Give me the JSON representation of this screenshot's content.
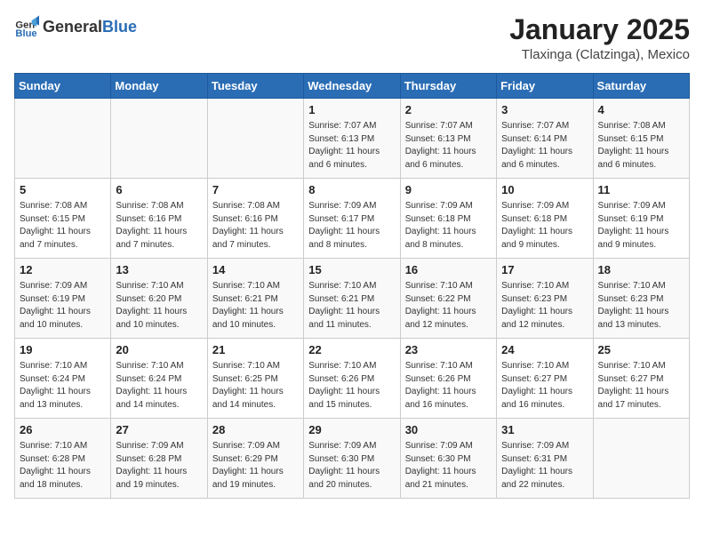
{
  "header": {
    "logo_general": "General",
    "logo_blue": "Blue",
    "title": "January 2025",
    "subtitle": "Tlaxinga (Clatzinga), Mexico"
  },
  "days_of_week": [
    "Sunday",
    "Monday",
    "Tuesday",
    "Wednesday",
    "Thursday",
    "Friday",
    "Saturday"
  ],
  "weeks": [
    [
      {
        "day": "",
        "info": ""
      },
      {
        "day": "",
        "info": ""
      },
      {
        "day": "",
        "info": ""
      },
      {
        "day": "1",
        "info": "Sunrise: 7:07 AM\nSunset: 6:13 PM\nDaylight: 11 hours\nand 6 minutes."
      },
      {
        "day": "2",
        "info": "Sunrise: 7:07 AM\nSunset: 6:13 PM\nDaylight: 11 hours\nand 6 minutes."
      },
      {
        "day": "3",
        "info": "Sunrise: 7:07 AM\nSunset: 6:14 PM\nDaylight: 11 hours\nand 6 minutes."
      },
      {
        "day": "4",
        "info": "Sunrise: 7:08 AM\nSunset: 6:15 PM\nDaylight: 11 hours\nand 6 minutes."
      }
    ],
    [
      {
        "day": "5",
        "info": "Sunrise: 7:08 AM\nSunset: 6:15 PM\nDaylight: 11 hours\nand 7 minutes."
      },
      {
        "day": "6",
        "info": "Sunrise: 7:08 AM\nSunset: 6:16 PM\nDaylight: 11 hours\nand 7 minutes."
      },
      {
        "day": "7",
        "info": "Sunrise: 7:08 AM\nSunset: 6:16 PM\nDaylight: 11 hours\nand 7 minutes."
      },
      {
        "day": "8",
        "info": "Sunrise: 7:09 AM\nSunset: 6:17 PM\nDaylight: 11 hours\nand 8 minutes."
      },
      {
        "day": "9",
        "info": "Sunrise: 7:09 AM\nSunset: 6:18 PM\nDaylight: 11 hours\nand 8 minutes."
      },
      {
        "day": "10",
        "info": "Sunrise: 7:09 AM\nSunset: 6:18 PM\nDaylight: 11 hours\nand 9 minutes."
      },
      {
        "day": "11",
        "info": "Sunrise: 7:09 AM\nSunset: 6:19 PM\nDaylight: 11 hours\nand 9 minutes."
      }
    ],
    [
      {
        "day": "12",
        "info": "Sunrise: 7:09 AM\nSunset: 6:19 PM\nDaylight: 11 hours\nand 10 minutes."
      },
      {
        "day": "13",
        "info": "Sunrise: 7:10 AM\nSunset: 6:20 PM\nDaylight: 11 hours\nand 10 minutes."
      },
      {
        "day": "14",
        "info": "Sunrise: 7:10 AM\nSunset: 6:21 PM\nDaylight: 11 hours\nand 10 minutes."
      },
      {
        "day": "15",
        "info": "Sunrise: 7:10 AM\nSunset: 6:21 PM\nDaylight: 11 hours\nand 11 minutes."
      },
      {
        "day": "16",
        "info": "Sunrise: 7:10 AM\nSunset: 6:22 PM\nDaylight: 11 hours\nand 12 minutes."
      },
      {
        "day": "17",
        "info": "Sunrise: 7:10 AM\nSunset: 6:23 PM\nDaylight: 11 hours\nand 12 minutes."
      },
      {
        "day": "18",
        "info": "Sunrise: 7:10 AM\nSunset: 6:23 PM\nDaylight: 11 hours\nand 13 minutes."
      }
    ],
    [
      {
        "day": "19",
        "info": "Sunrise: 7:10 AM\nSunset: 6:24 PM\nDaylight: 11 hours\nand 13 minutes."
      },
      {
        "day": "20",
        "info": "Sunrise: 7:10 AM\nSunset: 6:24 PM\nDaylight: 11 hours\nand 14 minutes."
      },
      {
        "day": "21",
        "info": "Sunrise: 7:10 AM\nSunset: 6:25 PM\nDaylight: 11 hours\nand 14 minutes."
      },
      {
        "day": "22",
        "info": "Sunrise: 7:10 AM\nSunset: 6:26 PM\nDaylight: 11 hours\nand 15 minutes."
      },
      {
        "day": "23",
        "info": "Sunrise: 7:10 AM\nSunset: 6:26 PM\nDaylight: 11 hours\nand 16 minutes."
      },
      {
        "day": "24",
        "info": "Sunrise: 7:10 AM\nSunset: 6:27 PM\nDaylight: 11 hours\nand 16 minutes."
      },
      {
        "day": "25",
        "info": "Sunrise: 7:10 AM\nSunset: 6:27 PM\nDaylight: 11 hours\nand 17 minutes."
      }
    ],
    [
      {
        "day": "26",
        "info": "Sunrise: 7:10 AM\nSunset: 6:28 PM\nDaylight: 11 hours\nand 18 minutes."
      },
      {
        "day": "27",
        "info": "Sunrise: 7:09 AM\nSunset: 6:28 PM\nDaylight: 11 hours\nand 19 minutes."
      },
      {
        "day": "28",
        "info": "Sunrise: 7:09 AM\nSunset: 6:29 PM\nDaylight: 11 hours\nand 19 minutes."
      },
      {
        "day": "29",
        "info": "Sunrise: 7:09 AM\nSunset: 6:30 PM\nDaylight: 11 hours\nand 20 minutes."
      },
      {
        "day": "30",
        "info": "Sunrise: 7:09 AM\nSunset: 6:30 PM\nDaylight: 11 hours\nand 21 minutes."
      },
      {
        "day": "31",
        "info": "Sunrise: 7:09 AM\nSunset: 6:31 PM\nDaylight: 11 hours\nand 22 minutes."
      },
      {
        "day": "",
        "info": ""
      }
    ]
  ]
}
